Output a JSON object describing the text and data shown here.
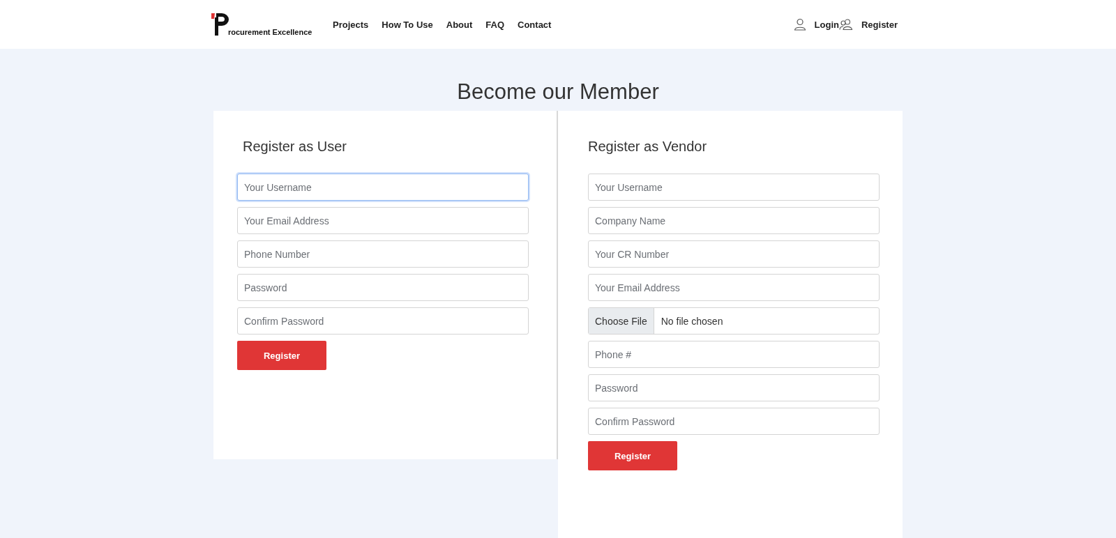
{
  "header": {
    "brand": "rocurement Excellence",
    "nav": [
      "Projects",
      "How To Use",
      "About",
      "FAQ",
      "Contact"
    ],
    "account": [
      {
        "kind": "login",
        "label": "Login"
      },
      {
        "kind": "register",
        "label": "Register"
      }
    ]
  },
  "title": "Become our Member",
  "forms": [
    {
      "heading": "Register as User",
      "fields": [
        {
          "kind": "text",
          "placeholder": "Your Username",
          "focused": true
        },
        {
          "kind": "text",
          "placeholder": "Your Email Address",
          "focused": false
        },
        {
          "kind": "text",
          "placeholder": "Phone Number",
          "focused": false
        },
        {
          "kind": "text",
          "placeholder": "Password",
          "focused": false
        },
        {
          "kind": "text",
          "placeholder": "Confirm Password",
          "focused": false
        }
      ],
      "button": "Register"
    },
    {
      "heading": "Register as Vendor",
      "fields": [
        {
          "kind": "text",
          "placeholder": "Your Username",
          "focused": false
        },
        {
          "kind": "text",
          "placeholder": "Company Name",
          "focused": false
        },
        {
          "kind": "text",
          "placeholder": "Your CR Number",
          "focused": false
        },
        {
          "kind": "text",
          "placeholder": "Your Email Address",
          "focused": false
        },
        {
          "kind": "file",
          "button": "Choose File",
          "value": "No file chosen",
          "focused": false
        },
        {
          "kind": "text",
          "placeholder": "Phone #",
          "focused": false
        },
        {
          "kind": "text",
          "placeholder": "Password",
          "focused": false
        },
        {
          "kind": "text",
          "placeholder": "Confirm Password",
          "focused": false
        }
      ],
      "button": "Register"
    }
  ]
}
